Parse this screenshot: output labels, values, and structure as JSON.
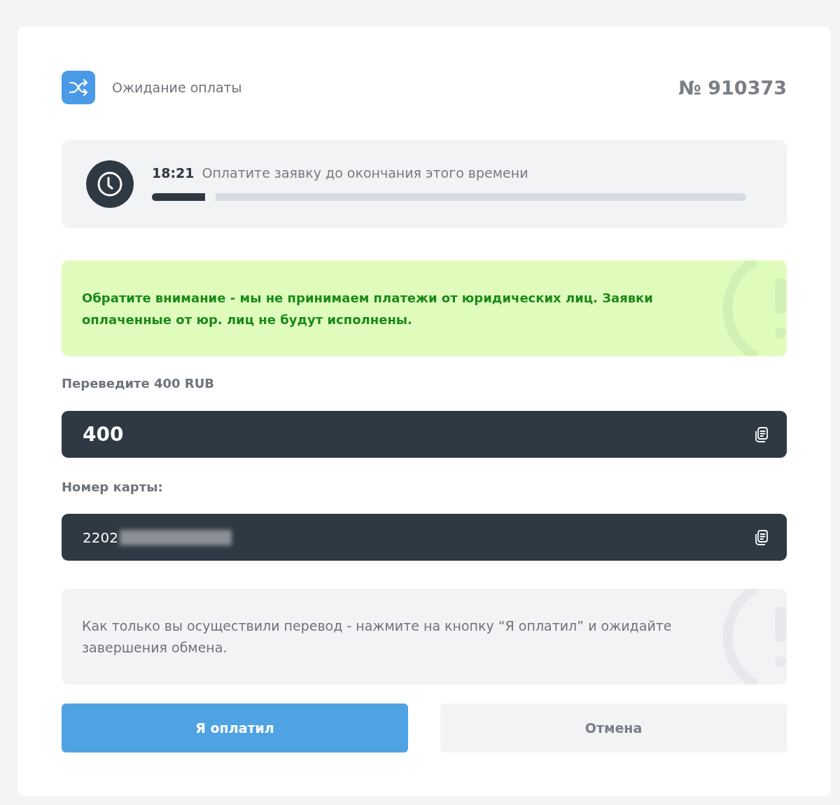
{
  "header": {
    "status": "Ожидание оплаты",
    "order_number": "№ 910373"
  },
  "timer": {
    "time": "18:21",
    "message": "Оплатите заявку до окончания этого времени",
    "level": 0.09
  },
  "notice": {
    "text": "Обратите внимание - мы не принимаем платежи от юридических лиц. Заявки оплаченные от юр. лиц не будут исполнены."
  },
  "fields": [
    {
      "label": "Переведите 400 RUB",
      "value": "400",
      "kind": "amount",
      "redacted": false
    },
    {
      "label": "Номер карты:",
      "value": "2202",
      "kind": "card",
      "redacted": true
    }
  ],
  "info": {
    "text": "Как только вы осуществили перевод - нажмите на кнопку “Я оплатил” и ожидайте завершения обмена."
  },
  "buttons": [
    {
      "label": "Я оплатил",
      "kind": "primary"
    },
    {
      "label": "Отмена",
      "kind": "secondary"
    }
  ]
}
